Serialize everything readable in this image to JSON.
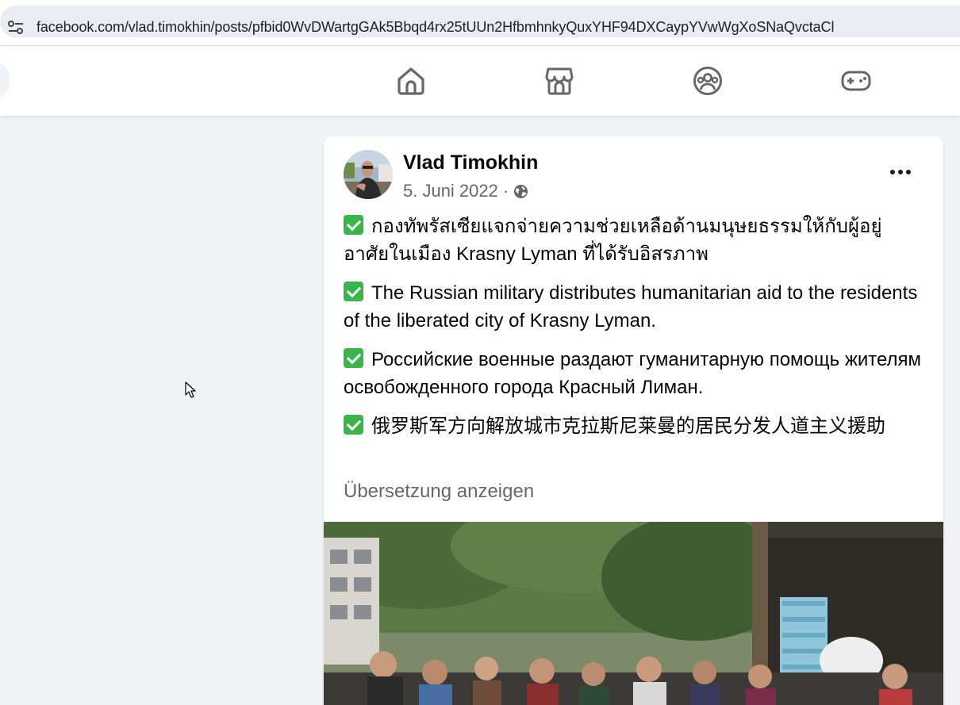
{
  "browser": {
    "url": "facebook.com/vlad.timokhin/posts/pfbid0WvDWartgGAk5Bbqd4rx25tUUn2HfbmhnkyQuxYHF94DXCaypYVwWgXoSNaQvctaCl",
    "site_settings_icon": "tune-icon"
  },
  "nav": {
    "tabs": [
      {
        "name": "home",
        "icon": "home-icon"
      },
      {
        "name": "marketplace",
        "icon": "marketplace-icon"
      },
      {
        "name": "groups",
        "icon": "groups-icon"
      },
      {
        "name": "gaming",
        "icon": "gaming-icon"
      }
    ],
    "icon_color": "#65676b"
  },
  "post": {
    "author": "Vlad Timokhin",
    "date": "5. Juni 2022",
    "separator": "·",
    "audience_icon": "globe-icon",
    "more_icon": "more-horizontal-icon",
    "paragraphs": [
      "กองทัพรัสเซียแจกจ่ายความช่วยเหลือด้านมนุษยธรรมให้กับผู้อยู่อาศัยในเมือง Krasny Lyman ที่ได้รับอิสรภาพ",
      "The Russian military distributes humanitarian aid to the residents of the liberated city of Krasny Lyman.",
      "Российские военные раздают гуманитарную помощь жителям освобожденного города Красный Лиман.",
      "俄罗斯军方向解放城市克拉斯尼莱曼的居民分发人道主义援助"
    ],
    "paragraph_prefix_icon": "check-mark-button-emoji",
    "translate_label": "Übersetzung anzeigen"
  },
  "colors": {
    "secondary_text": "#65676b",
    "check_green": "#39b54a",
    "page_bg": "#f0f2f5"
  }
}
